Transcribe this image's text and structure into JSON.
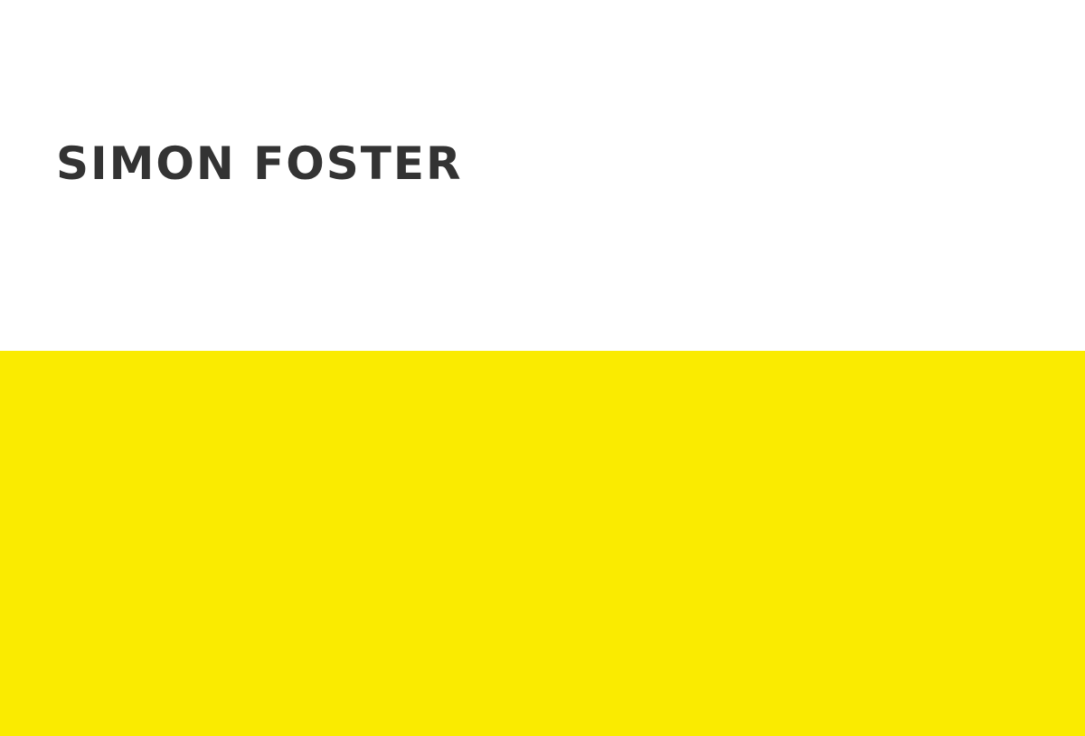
{
  "site": {
    "title": "SIMON FOSTER"
  },
  "colors": {
    "background": "#ffffff",
    "title_text": "#333333",
    "accent_panel": "#FAEB00"
  }
}
